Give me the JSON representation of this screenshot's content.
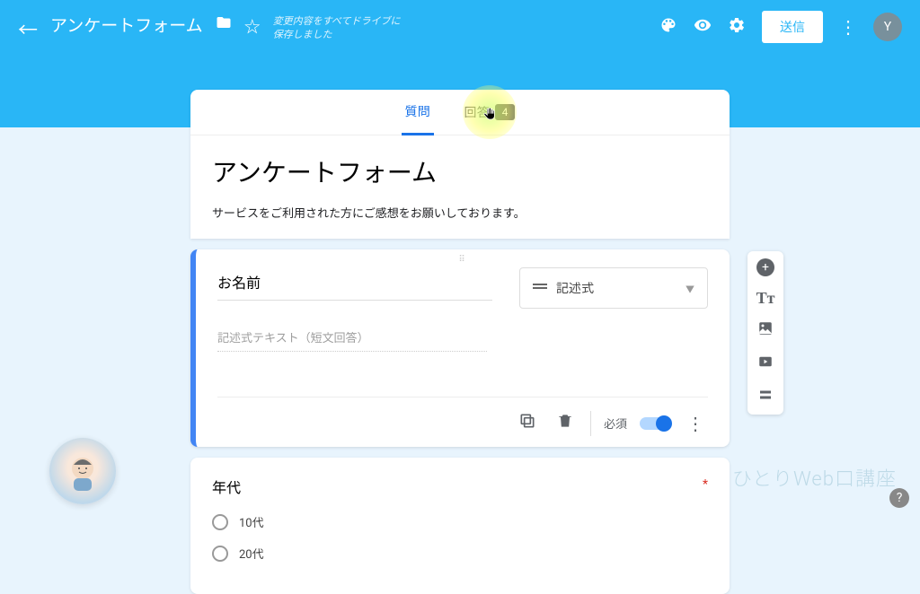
{
  "header": {
    "title": "アンケートフォーム",
    "save_status": "変更内容をすべてドライブに\n保存しました",
    "send_label": "送信",
    "avatar_letter": "Y"
  },
  "tabs": {
    "questions": "質問",
    "responses": "回答",
    "response_count": "4"
  },
  "form": {
    "title": "アンケートフォーム",
    "description": "サービスをご利用された方にご感想をお願いしております。"
  },
  "question1": {
    "title": "お名前",
    "type_label": "記述式",
    "placeholder": "記述式テキスト（短文回答）",
    "required_label": "必須"
  },
  "question2": {
    "title": "年代",
    "options": [
      "10代",
      "20代"
    ]
  },
  "watermark": "ひとりWeb口講座",
  "help": "?"
}
